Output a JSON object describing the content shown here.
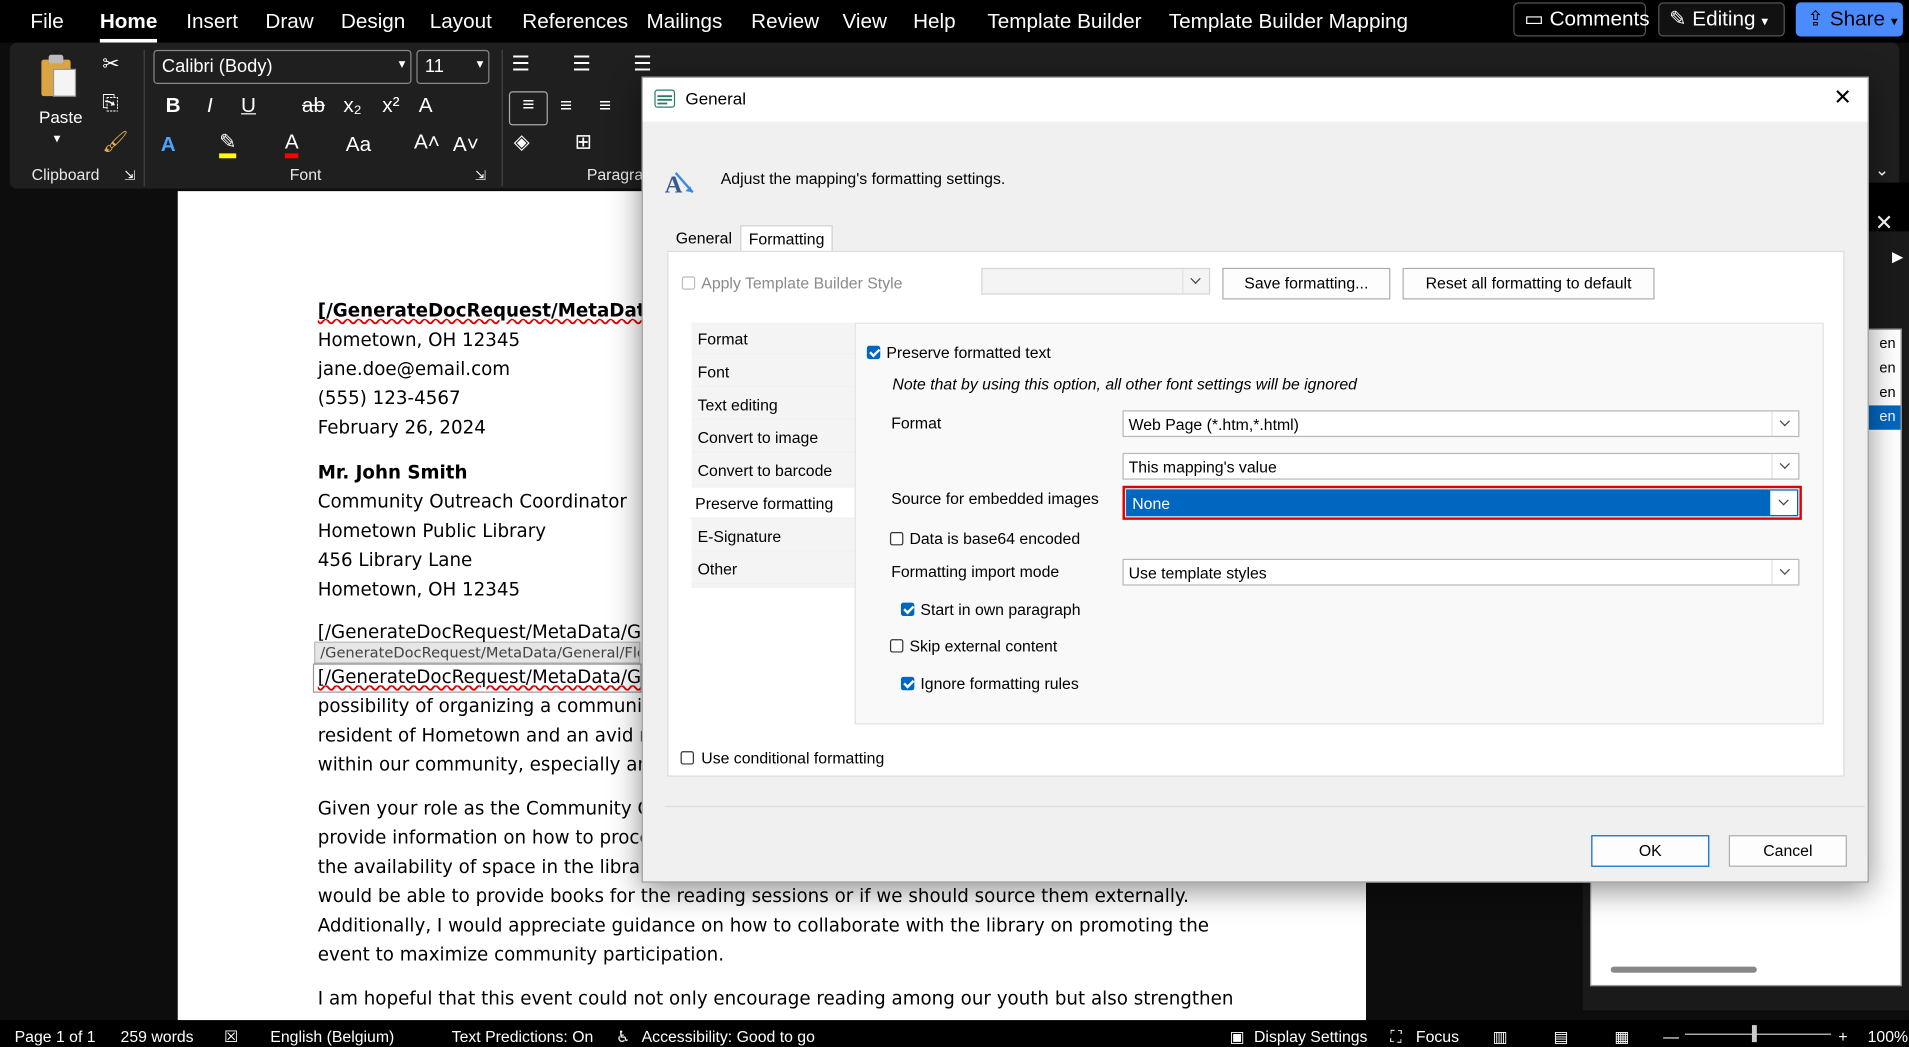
{
  "menu": {
    "items": [
      "File",
      "Home",
      "Insert",
      "Draw",
      "Design",
      "Layout",
      "References",
      "Mailings",
      "Review",
      "View",
      "Help",
      "Template Builder",
      "Template Builder Mapping"
    ],
    "active": "Home",
    "comments": "Comments",
    "editing": "Editing",
    "share": "Share"
  },
  "ribbon": {
    "paste": "Paste",
    "clipboard": "Clipboard",
    "font_group": "Font",
    "paragraph_group": "Paragra",
    "font_name": "Calibri (Body)",
    "font_size": "11"
  },
  "document": {
    "lines": [
      {
        "text": "[/GenerateDocRequest/MetaData/",
        "bold": true,
        "squig": true
      },
      {
        "text": "Hometown, OH 12345"
      },
      {
        "text": "jane.doe@email.com"
      },
      {
        "text": "(555) 123-4567"
      },
      {
        "text": "February 26, 2024"
      },
      {
        "text": "Mr. John Smith",
        "bold": true
      },
      {
        "text": "Community Outreach Coordinator"
      },
      {
        "text": "Hometown Public Library"
      },
      {
        "text": "456 Library Lane"
      },
      {
        "text": "Hometown, OH 12345"
      },
      {
        "text": "[/GenerateDocRequest/MetaData/G"
      },
      {
        "text": "[/GenerateDocRequest/MetaData/G",
        "squig": true
      },
      {
        "text": "possibility of organizing a communit"
      },
      {
        "text": "resident of Hometown and an avid r"
      },
      {
        "text": "within our community, especially am"
      },
      {
        "text": "Given your role as the Community O"
      },
      {
        "text": "provide information on how to proce"
      },
      {
        "text": "the availability of space in the library"
      },
      {
        "text": "would be able to provide books for the reading sessions or if we should source them externally."
      },
      {
        "text": "Additionally, I would appreciate guidance on how to collaborate with the library on promoting the"
      },
      {
        "text": "event to maximize community participation."
      },
      {
        "text": "I am hopeful that this event could not only encourage reading among our youth but also strengthen"
      }
    ],
    "field_tooltip": "/GenerateDocRequest/MetaData/General/Flo"
  },
  "right_pane": {
    "items": [
      "en",
      "en",
      "en",
      "en"
    ]
  },
  "status": {
    "page": "Page 1 of 1",
    "words": "259 words",
    "language": "English (Belgium)",
    "predictions": "Text Predictions: On",
    "accessibility": "Accessibility: Good to go",
    "display": "Display Settings",
    "focus": "Focus",
    "zoom": "100%"
  },
  "dialog": {
    "title": "General",
    "description": "Adjust the mapping's formatting settings.",
    "tabs": [
      "General",
      "Formatting"
    ],
    "active_tab": "Formatting",
    "apply_style_label": "Apply Template Builder Style",
    "save_formatting": "Save formatting...",
    "reset_formatting": "Reset all formatting to default",
    "nav": [
      "Format",
      "Font",
      "Text editing",
      "Convert to image",
      "Convert to barcode",
      "Preserve formatting",
      "E-Signature",
      "Other"
    ],
    "nav_selected": "Preserve formatting",
    "preserve_label": "Preserve formatted text",
    "note": "Note that by using this option, all other font settings will be ignored",
    "format_label": "Format",
    "format_value": "Web Page (*.htm,*.html)",
    "source_value": "This mapping's value",
    "embedded_label": "Source for embedded images",
    "embedded_value": "None",
    "base64_label": "Data is base64 encoded",
    "import_mode_label": "Formatting import mode",
    "import_mode_value": "Use template styles",
    "own_paragraph_label": "Start in own paragraph",
    "skip_external_label": "Skip external content",
    "ignore_rules_label": "Ignore formatting rules",
    "conditional_label": "Use conditional formatting",
    "ok": "OK",
    "cancel": "Cancel"
  }
}
